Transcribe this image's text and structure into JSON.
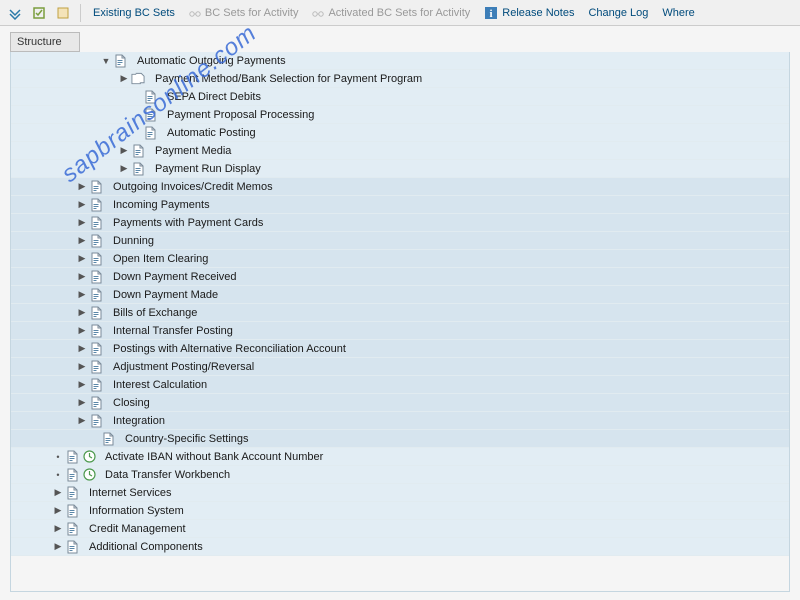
{
  "toolbar": {
    "items": [
      {
        "label": "Existing BC Sets"
      },
      {
        "label": "BC Sets for Activity",
        "disabled": true
      },
      {
        "label": "Activated BC Sets for Activity",
        "disabled": true
      },
      {
        "label": "Release Notes",
        "info": true
      },
      {
        "label": "Change Log"
      },
      {
        "label": "Where"
      }
    ]
  },
  "structure_label": "Structure",
  "watermark": "sapbrainsonline.com",
  "tree": [
    {
      "indent": 90,
      "expander": "▼",
      "icon": "doc",
      "clock": false,
      "label": "Automatic Outgoing Payments",
      "bg": "light"
    },
    {
      "indent": 108,
      "expander": "▶",
      "icon": "doc2",
      "clock": false,
      "label": "Payment Method/Bank Selection for Payment Program",
      "bg": "light"
    },
    {
      "indent": 120,
      "expander": "",
      "icon": "doc",
      "clock": false,
      "label": "SEPA Direct Debits",
      "bg": "light"
    },
    {
      "indent": 120,
      "expander": "",
      "icon": "doc",
      "clock": false,
      "label": "Payment Proposal Processing",
      "bg": "light"
    },
    {
      "indent": 120,
      "expander": "",
      "icon": "doc",
      "clock": false,
      "label": "Automatic Posting",
      "bg": "light"
    },
    {
      "indent": 108,
      "expander": "▶",
      "icon": "doc",
      "clock": false,
      "label": "Payment Media",
      "bg": "light"
    },
    {
      "indent": 108,
      "expander": "▶",
      "icon": "doc",
      "clock": false,
      "label": "Payment Run Display",
      "bg": "light"
    },
    {
      "indent": 66,
      "expander": "▶",
      "icon": "doc",
      "clock": false,
      "label": "Outgoing Invoices/Credit Memos",
      "bg": "dark"
    },
    {
      "indent": 66,
      "expander": "▶",
      "icon": "doc",
      "clock": false,
      "label": "Incoming Payments",
      "bg": "dark"
    },
    {
      "indent": 66,
      "expander": "▶",
      "icon": "doc",
      "clock": false,
      "label": "Payments with Payment Cards",
      "bg": "dark"
    },
    {
      "indent": 66,
      "expander": "▶",
      "icon": "doc",
      "clock": false,
      "label": "Dunning",
      "bg": "dark"
    },
    {
      "indent": 66,
      "expander": "▶",
      "icon": "doc",
      "clock": false,
      "label": "Open Item Clearing",
      "bg": "dark"
    },
    {
      "indent": 66,
      "expander": "▶",
      "icon": "doc",
      "clock": false,
      "label": "Down Payment Received",
      "bg": "dark"
    },
    {
      "indent": 66,
      "expander": "▶",
      "icon": "doc",
      "clock": false,
      "label": "Down Payment Made",
      "bg": "dark"
    },
    {
      "indent": 66,
      "expander": "▶",
      "icon": "doc",
      "clock": false,
      "label": "Bills of Exchange",
      "bg": "dark"
    },
    {
      "indent": 66,
      "expander": "▶",
      "icon": "doc",
      "clock": false,
      "label": "Internal Transfer Posting",
      "bg": "dark"
    },
    {
      "indent": 66,
      "expander": "▶",
      "icon": "doc",
      "clock": false,
      "label": "Postings with Alternative Reconciliation Account",
      "bg": "dark"
    },
    {
      "indent": 66,
      "expander": "▶",
      "icon": "doc",
      "clock": false,
      "label": "Adjustment Posting/Reversal",
      "bg": "dark"
    },
    {
      "indent": 66,
      "expander": "▶",
      "icon": "doc",
      "clock": false,
      "label": "Interest Calculation",
      "bg": "dark"
    },
    {
      "indent": 66,
      "expander": "▶",
      "icon": "doc",
      "clock": false,
      "label": "Closing",
      "bg": "dark"
    },
    {
      "indent": 66,
      "expander": "▶",
      "icon": "doc",
      "clock": false,
      "label": "Integration",
      "bg": "dark"
    },
    {
      "indent": 78,
      "expander": "",
      "icon": "doc",
      "clock": false,
      "label": "Country-Specific Settings",
      "bg": "dark"
    },
    {
      "indent": 42,
      "expander": "•",
      "icon": "doc",
      "clock": true,
      "label": "Activate IBAN without Bank Account Number",
      "bg": "light"
    },
    {
      "indent": 42,
      "expander": "•",
      "icon": "doc",
      "clock": true,
      "label": "Data Transfer Workbench",
      "bg": "light"
    },
    {
      "indent": 42,
      "expander": "▶",
      "icon": "doc",
      "clock": false,
      "label": "Internet Services",
      "bg": "light"
    },
    {
      "indent": 42,
      "expander": "▶",
      "icon": "doc",
      "clock": false,
      "label": "Information System",
      "bg": "light"
    },
    {
      "indent": 42,
      "expander": "▶",
      "icon": "doc",
      "clock": false,
      "label": "Credit Management",
      "bg": "light"
    },
    {
      "indent": 42,
      "expander": "▶",
      "icon": "doc",
      "clock": false,
      "label": "Additional Components",
      "bg": "light"
    }
  ]
}
